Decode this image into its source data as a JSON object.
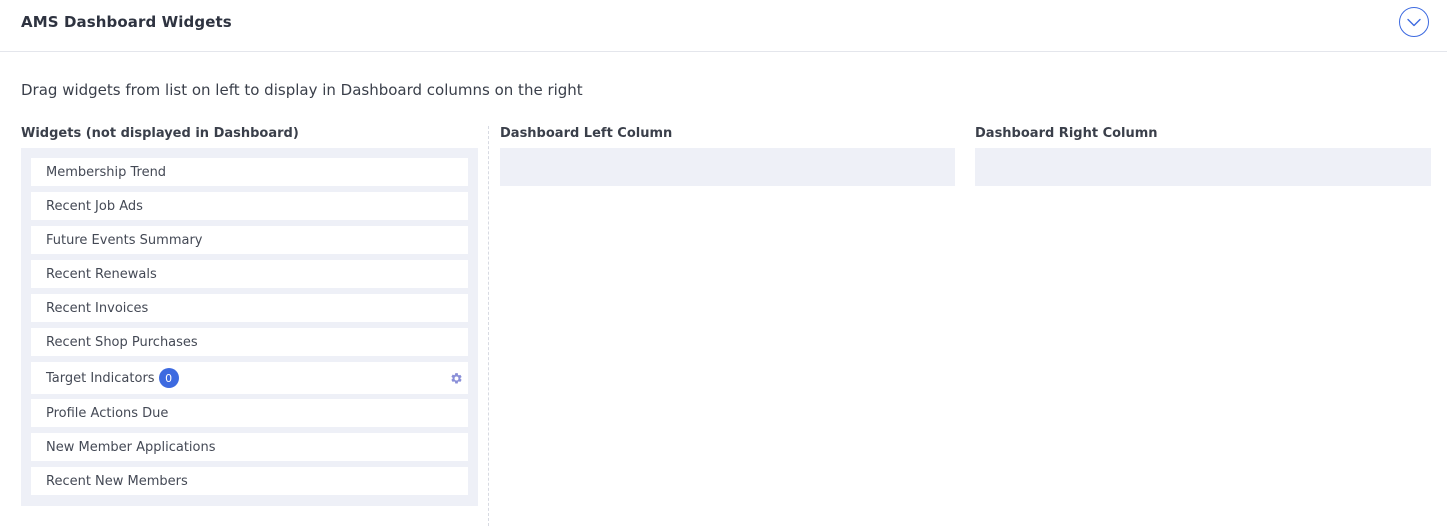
{
  "header": {
    "title": "AMS Dashboard Widgets",
    "collapse_icon": "chevron-down-icon"
  },
  "instructions": "Drag widgets from list on left to display in Dashboard columns on the right",
  "columns": {
    "available_title": "Widgets (not displayed in Dashboard)",
    "left_title": "Dashboard Left Column",
    "right_title": "Dashboard Right Column"
  },
  "widgets": [
    {
      "label": "Membership Trend"
    },
    {
      "label": "Recent Job Ads"
    },
    {
      "label": "Future Events Summary"
    },
    {
      "label": "Recent Renewals"
    },
    {
      "label": "Recent Invoices"
    },
    {
      "label": "Recent Shop Purchases"
    },
    {
      "label": "Target Indicators",
      "badge": "0",
      "icon": "gear-icon"
    },
    {
      "label": "Profile Actions Due"
    },
    {
      "label": "New Member Applications"
    },
    {
      "label": "Recent New Members"
    }
  ],
  "colors": {
    "accent": "#3d6ae0",
    "panel_bg": "#eef0f7"
  }
}
